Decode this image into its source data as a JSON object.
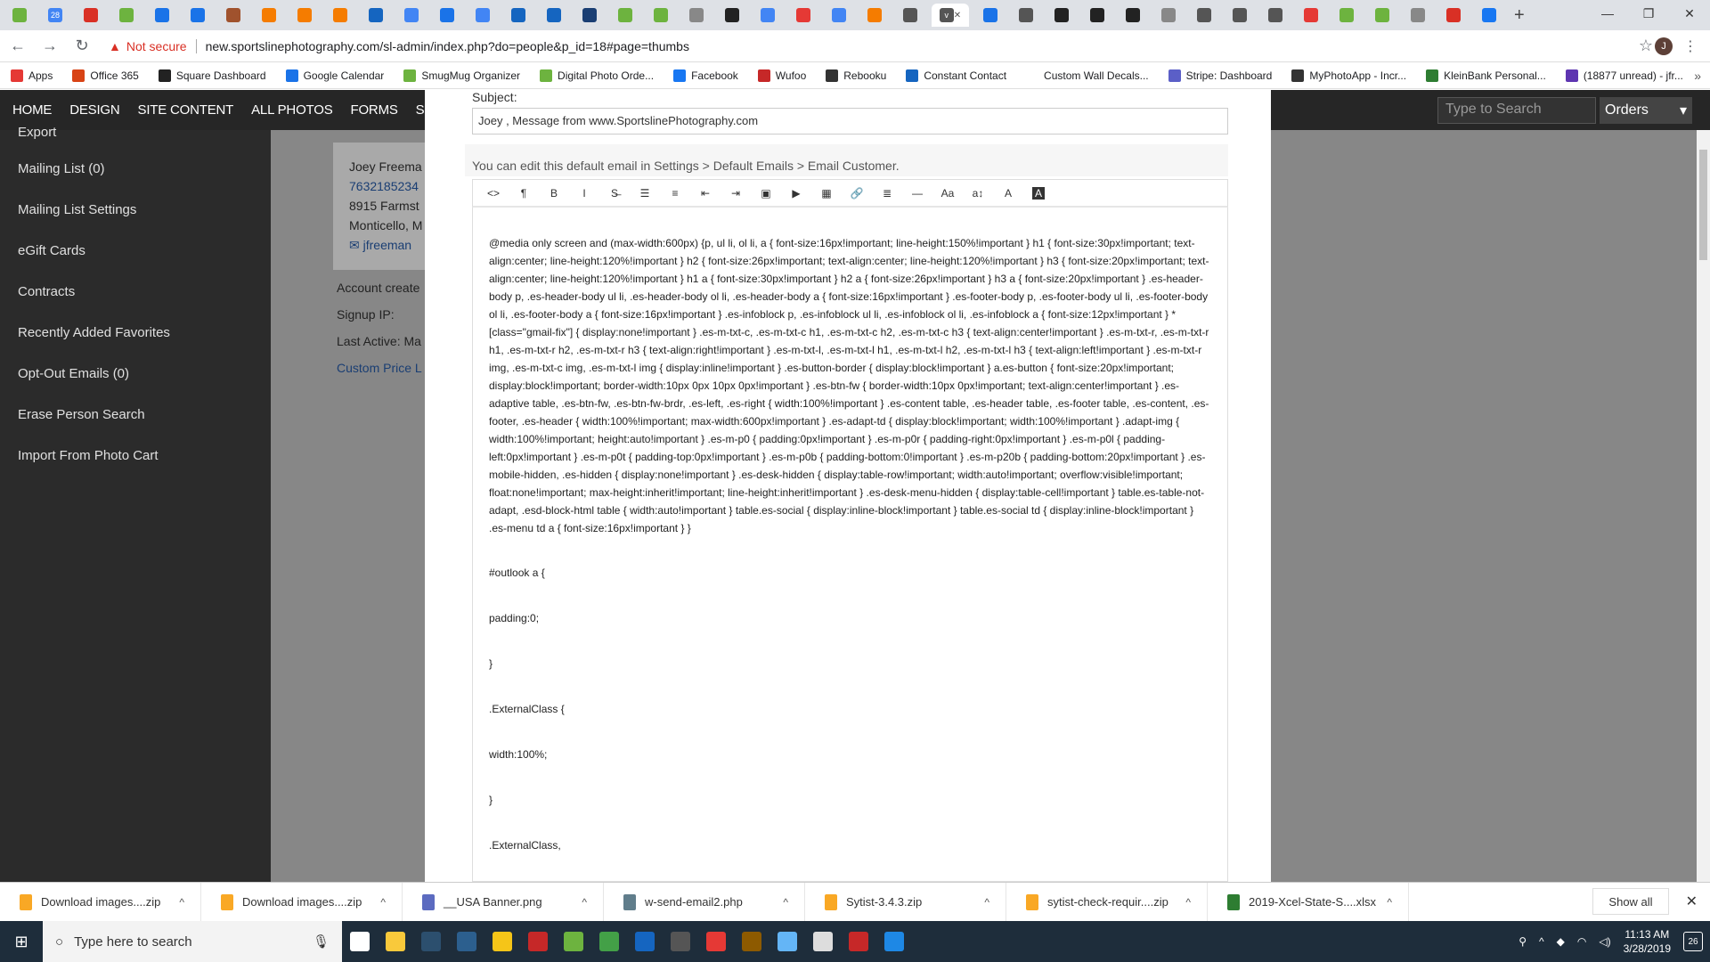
{
  "browser": {
    "tabs": [
      {
        "icon": "smugmug-icon",
        "color": "#6db33f"
      },
      {
        "icon": "calendar-icon",
        "color": "#4285f4",
        "text": "28"
      },
      {
        "icon": "mail-icon",
        "color": "#d93025"
      },
      {
        "icon": "leaf-icon",
        "color": "#6db33f"
      },
      {
        "icon": "dash-icon",
        "color": "#1a73e8"
      },
      {
        "icon": "dash-icon",
        "color": "#1a73e8"
      },
      {
        "icon": "hand-icon",
        "color": "#a0522d"
      },
      {
        "icon": "link-icon",
        "color": "#f57c00"
      },
      {
        "icon": "link-icon",
        "color": "#f57c00"
      },
      {
        "icon": "link-icon",
        "color": "#f57c00"
      },
      {
        "icon": "outlook-icon",
        "color": "#1565c0"
      },
      {
        "icon": "google-icon",
        "color": "#4285f4"
      },
      {
        "icon": "download-icon",
        "color": "#1a73e8"
      },
      {
        "icon": "google-icon",
        "color": "#4285f4"
      },
      {
        "icon": "undo-icon",
        "color": "#1565c0"
      },
      {
        "icon": "undo-icon",
        "color": "#1565c0"
      },
      {
        "icon": "grid-icon",
        "color": "#1a3e73"
      },
      {
        "icon": "smugmug-icon",
        "color": "#6db33f"
      },
      {
        "icon": "smugmug-icon",
        "color": "#6db33f"
      },
      {
        "icon": "page-icon",
        "color": "#888888"
      },
      {
        "icon": "square-icon",
        "color": "#222222"
      },
      {
        "icon": "google-icon",
        "color": "#4285f4"
      },
      {
        "icon": "youtube-icon",
        "color": "#e53935"
      },
      {
        "icon": "google-icon",
        "color": "#4285f4"
      },
      {
        "icon": "photo-icon",
        "color": "#f57c00"
      },
      {
        "icon": "copy-icon",
        "color": "#555555"
      },
      {
        "icon": "site-icon",
        "color": "#555555",
        "text": "v",
        "active": true
      },
      {
        "icon": "dash-icon",
        "color": "#1a73e8"
      },
      {
        "icon": "copy-icon",
        "color": "#555555"
      },
      {
        "icon": "square-icon",
        "color": "#222222"
      },
      {
        "icon": "square-icon",
        "color": "#222222"
      },
      {
        "icon": "square-icon",
        "color": "#222222"
      },
      {
        "icon": "page-icon",
        "color": "#888888"
      },
      {
        "icon": "copy-icon",
        "color": "#555555"
      },
      {
        "icon": "copy-icon",
        "color": "#555555"
      },
      {
        "icon": "copy-icon",
        "color": "#555555"
      },
      {
        "icon": "red-icon",
        "color": "#e53935"
      },
      {
        "icon": "leaf-icon",
        "color": "#6db33f"
      },
      {
        "icon": "leaf-icon",
        "color": "#6db33f"
      },
      {
        "icon": "page-icon",
        "color": "#888888"
      },
      {
        "icon": "q-icon",
        "color": "#d93025"
      },
      {
        "icon": "facebook-icon",
        "color": "#1877f2"
      }
    ],
    "new_tab": "+",
    "window_controls": {
      "minimize": "—",
      "restore": "❐",
      "close": "✕"
    },
    "nav": {
      "back": "←",
      "forward": "→",
      "reload": "↻"
    },
    "security_label": "Not secure",
    "url": "new.sportslinephotography.com/sl-admin/index.php?do=people&p_id=18#page=thumbs",
    "avatar_letter": "J",
    "bookmarks": [
      {
        "label": "Apps",
        "icon": "apps-icon",
        "color": "#e53935"
      },
      {
        "label": "Office 365",
        "icon": "office-icon",
        "color": "#d84315"
      },
      {
        "label": "Square Dashboard",
        "icon": "square-icon",
        "color": "#222222"
      },
      {
        "label": "Google Calendar",
        "icon": "calendar-icon",
        "color": "#1a73e8"
      },
      {
        "label": "SmugMug Organizer",
        "icon": "smugmug-icon",
        "color": "#6db33f"
      },
      {
        "label": "Digital Photo Orde...",
        "icon": "smugmug-icon",
        "color": "#6db33f"
      },
      {
        "label": "Facebook",
        "icon": "facebook-icon",
        "color": "#1877f2"
      },
      {
        "label": "Wufoo",
        "icon": "wufoo-icon",
        "color": "#c62828"
      },
      {
        "label": "Rebooku",
        "icon": "rebooku-icon",
        "color": "#333333"
      },
      {
        "label": "Constant Contact",
        "icon": "cc-icon",
        "color": "#1565c0"
      },
      {
        "label": "Custom Wall Decals...",
        "icon": "blank-icon",
        "color": "#ffffff"
      },
      {
        "label": "Stripe: Dashboard",
        "icon": "stripe-icon",
        "color": "#5b5fc7"
      },
      {
        "label": "MyPhotoApp - Incr...",
        "icon": "photoapp-icon",
        "color": "#333333"
      },
      {
        "label": "KleinBank Personal...",
        "icon": "bank-icon",
        "color": "#2e7d32"
      },
      {
        "label": "(18877 unread) - jfr...",
        "icon": "mail-icon",
        "color": "#5e35b1"
      }
    ],
    "bookmarks_more": "»"
  },
  "admin": {
    "nav": [
      "HOME",
      "DESIGN",
      "SITE CONTENT",
      "ALL PHOTOS",
      "FORMS",
      "S"
    ],
    "search_placeholder": "Type to Search",
    "orders_label": "Orders",
    "orders_caret": "▾",
    "sidebar": [
      "Export",
      "Mailing List (0)",
      "Mailing List Settings",
      "eGift Cards",
      "Contracts",
      "Recently Added Favorites",
      "Opt-Out Emails (0)",
      "Erase Person Search",
      "Import From Photo Cart"
    ],
    "person": {
      "name": "Joey Freema",
      "phone": "7632185234",
      "address1": "8915 Farmst",
      "address2": "Monticello, M",
      "email": "jfreeman"
    },
    "meta": [
      "Account create",
      "Signup IP:",
      "Last Active: Ma",
      "Custom Price L"
    ]
  },
  "modal": {
    "subject_label": "Subject:",
    "subject_value": "Joey , Message from www.SportslinePhotography.com",
    "edit_note": "You can edit this default email in Settings > Default Emails > Email Customer.",
    "toolbar": [
      {
        "name": "code-view-icon",
        "glyph": "<>"
      },
      {
        "name": "paragraph-icon",
        "glyph": "¶"
      },
      {
        "name": "bold-icon",
        "glyph": "B"
      },
      {
        "name": "italic-icon",
        "glyph": "I"
      },
      {
        "name": "strikethrough-icon",
        "glyph": "S̶"
      },
      {
        "name": "bullet-list-icon",
        "glyph": "☰"
      },
      {
        "name": "numbered-list-icon",
        "glyph": "≡"
      },
      {
        "name": "outdent-icon",
        "glyph": "⇤"
      },
      {
        "name": "indent-icon",
        "glyph": "⇥"
      },
      {
        "name": "image-icon",
        "glyph": "▣"
      },
      {
        "name": "video-icon",
        "glyph": "▶"
      },
      {
        "name": "table-icon",
        "glyph": "▦"
      },
      {
        "name": "link-icon",
        "glyph": "🔗"
      },
      {
        "name": "align-icon",
        "glyph": "≣"
      },
      {
        "name": "horizontal-rule-icon",
        "glyph": "—"
      },
      {
        "name": "font-size-icon",
        "glyph": "Aa"
      },
      {
        "name": "line-height-icon",
        "glyph": "a↕"
      },
      {
        "name": "font-color-icon",
        "glyph": "A"
      },
      {
        "name": "background-color-icon",
        "glyph": "A"
      }
    ],
    "editor_css": "@media only screen and (max-width:600px) {p, ul li, ol li, a { font-size:16px!important; line-height:150%!important } h1 { font-size:30px!important; text-align:center; line-height:120%!important } h2 { font-size:26px!important; text-align:center; line-height:120%!important } h3 { font-size:20px!important; text-align:center; line-height:120%!important } h1 a { font-size:30px!important } h2 a { font-size:26px!important } h3 a { font-size:20px!important } .es-header-body p, .es-header-body ul li, .es-header-body ol li, .es-header-body a { font-size:16px!important } .es-footer-body p, .es-footer-body ul li, .es-footer-body ol li, .es-footer-body a { font-size:16px!important } .es-infoblock p, .es-infoblock ul li, .es-infoblock ol li, .es-infoblock a { font-size:12px!important } *[class=\"gmail-fix\"] { display:none!important } .es-m-txt-c, .es-m-txt-c h1, .es-m-txt-c h2, .es-m-txt-c h3 { text-align:center!important } .es-m-txt-r, .es-m-txt-r h1, .es-m-txt-r h2, .es-m-txt-r h3 { text-align:right!important } .es-m-txt-l, .es-m-txt-l h1, .es-m-txt-l h2, .es-m-txt-l h3 { text-align:left!important } .es-m-txt-r img, .es-m-txt-c img, .es-m-txt-l img { display:inline!important } .es-button-border { display:block!important } a.es-button { font-size:20px!important; display:block!important; border-width:10px 0px 10px 0px!important } .es-btn-fw { border-width:10px 0px!important; text-align:center!important } .es-adaptive table, .es-btn-fw, .es-btn-fw-brdr, .es-left, .es-right { width:100%!important } .es-content table, .es-header table, .es-footer table, .es-content, .es-footer, .es-header { width:100%!important; max-width:600px!important } .es-adapt-td { display:block!important; width:100%!important } .adapt-img { width:100%!important; height:auto!important } .es-m-p0 { padding:0px!important } .es-m-p0r { padding-right:0px!important } .es-m-p0l { padding-left:0px!important } .es-m-p0t { padding-top:0px!important } .es-m-p0b { padding-bottom:0!important } .es-m-p20b { padding-bottom:20px!important } .es-mobile-hidden, .es-hidden { display:none!important } .es-desk-hidden { display:table-row!important; width:auto!important; overflow:visible!important; float:none!important; max-height:inherit!important; line-height:inherit!important } .es-desk-menu-hidden { display:table-cell!important } table.es-table-not-adapt, .esd-block-html table { width:auto!important } table.es-social { display:inline-block!important } table.es-social td { display:inline-block!important } .es-menu td a { font-size:16px!important } }",
    "editor_lines": [
      "#outlook a {",
      "padding:0;",
      "}",
      ".ExternalClass {",
      "width:100%;",
      "}",
      ".ExternalClass,"
    ]
  },
  "downloads": {
    "items": [
      {
        "name": "Download images....zip",
        "icon": "zip-icon",
        "color": "#f9a825"
      },
      {
        "name": "Download images....zip",
        "icon": "zip-icon",
        "color": "#f9a825"
      },
      {
        "name": "__USA Banner.png",
        "icon": "image-file-icon",
        "color": "#5c6bc0"
      },
      {
        "name": "w-send-email2.php",
        "icon": "php-file-icon",
        "color": "#607d8b"
      },
      {
        "name": "Sytist-3.4.3.zip",
        "icon": "zip-icon",
        "color": "#f9a825"
      },
      {
        "name": "sytist-check-requir....zip",
        "icon": "zip-icon",
        "color": "#f9a825"
      },
      {
        "name": "2019-Xcel-State-S....xlsx",
        "icon": "excel-file-icon",
        "color": "#2e7d32"
      }
    ],
    "chevron": "^",
    "show_all": "Show all",
    "close": "✕"
  },
  "taskbar": {
    "search_placeholder": "Type here to search",
    "apps": [
      {
        "name": "task-view-icon",
        "color": "#ffffff"
      },
      {
        "name": "file-explorer-icon",
        "color": "#f9c93b"
      },
      {
        "name": "lightroom-icon",
        "color": "#2c4f6e"
      },
      {
        "name": "photoshop-icon",
        "color": "#2c5f8e"
      },
      {
        "name": "project-icon",
        "color": "#f5c518"
      },
      {
        "name": "app-red-icon",
        "color": "#c62828"
      },
      {
        "name": "smugmug-icon",
        "color": "#6db33f"
      },
      {
        "name": "app-green-icon",
        "color": "#43a047"
      },
      {
        "name": "outlook-icon",
        "color": "#1565c0"
      },
      {
        "name": "calculator-icon",
        "color": "#555555"
      },
      {
        "name": "chrome-icon",
        "color": "#e53935"
      },
      {
        "name": "bridge-icon",
        "color": "#8d5a00"
      },
      {
        "name": "app-blue-icon",
        "color": "#64b5f6"
      },
      {
        "name": "mail-icon",
        "color": "#dddddd"
      },
      {
        "name": "filezilla-icon",
        "color": "#c62828"
      },
      {
        "name": "edge-icon",
        "color": "#1e88e5"
      }
    ],
    "time": "11:13 AM",
    "date": "3/28/2019",
    "notifications": "26"
  }
}
